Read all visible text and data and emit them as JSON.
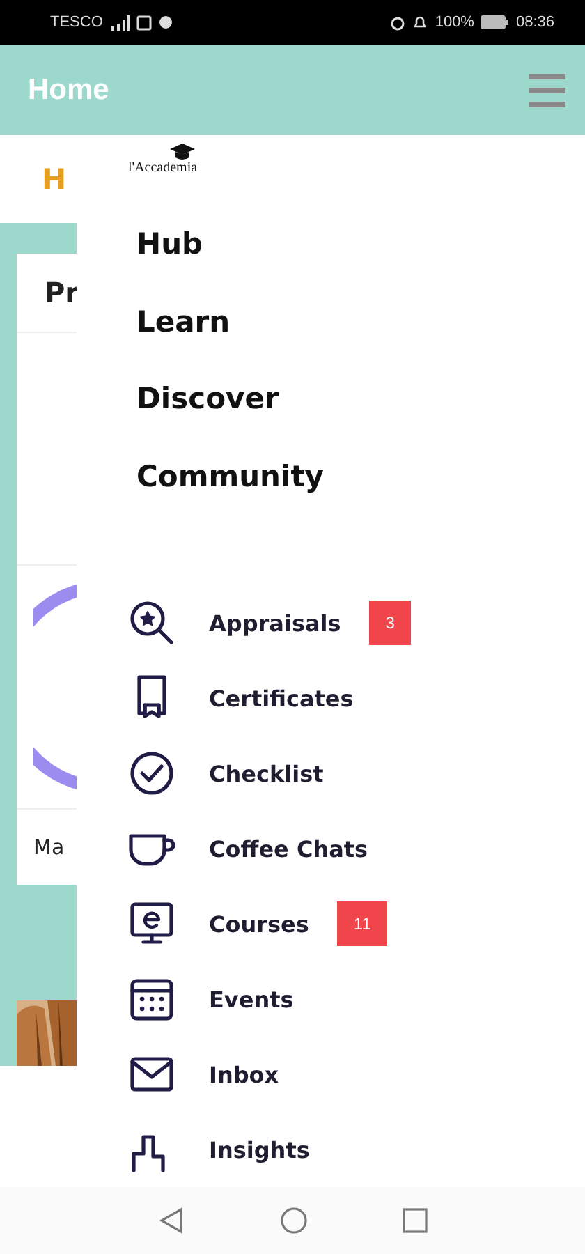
{
  "status_bar": {
    "carrier": "TESCO",
    "battery": "100%",
    "time": "08:36"
  },
  "app_bar": {
    "title": "Home"
  },
  "background": {
    "tab": "H",
    "card_title": "Pr",
    "card_footer": "Ma"
  },
  "drawer": {
    "logo": "l'Accademia",
    "nav": [
      "Hub",
      "Learn",
      "Discover",
      "Community"
    ],
    "items": [
      {
        "kind": "appraisals",
        "label": "Appraisals",
        "badge": "3"
      },
      {
        "kind": "certificates",
        "label": "Certificates"
      },
      {
        "kind": "checklist",
        "label": "Checklist"
      },
      {
        "kind": "coffee",
        "label": "Coffee Chats"
      },
      {
        "kind": "courses",
        "label": "Courses",
        "badge": "11"
      },
      {
        "kind": "events",
        "label": "Events"
      },
      {
        "kind": "inbox",
        "label": "Inbox"
      },
      {
        "kind": "insights",
        "label": "Insights"
      }
    ]
  }
}
